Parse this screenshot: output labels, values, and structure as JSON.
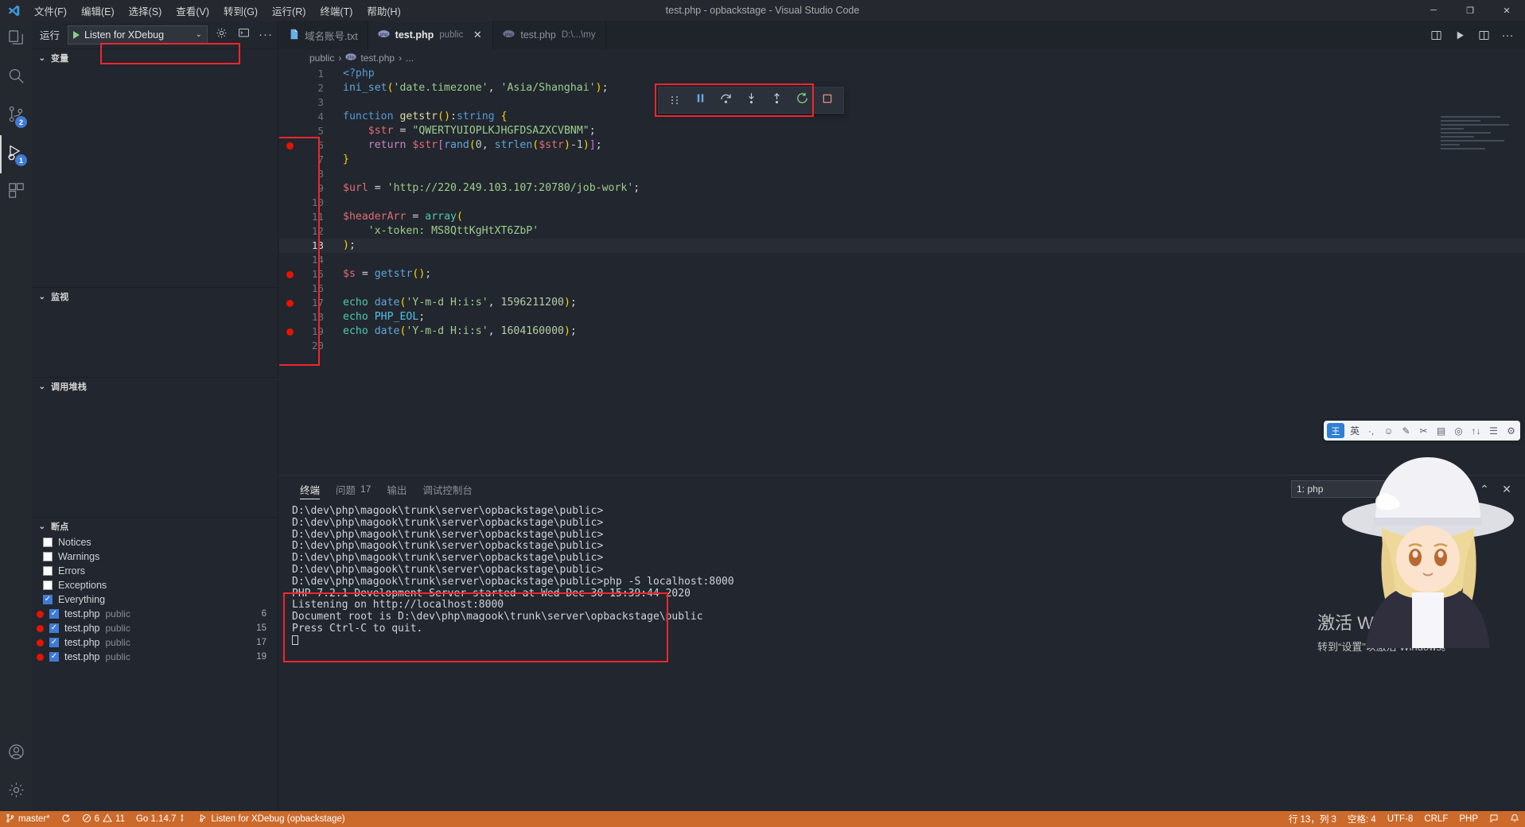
{
  "window": {
    "title": "test.php - opbackstage - Visual Studio Code",
    "minimize": "─",
    "maximize": "❐",
    "close": "✕"
  },
  "menubar": [
    {
      "label": "文件(F)"
    },
    {
      "label": "编辑(E)"
    },
    {
      "label": "选择(S)"
    },
    {
      "label": "查看(V)"
    },
    {
      "label": "转到(G)"
    },
    {
      "label": "运行(R)"
    },
    {
      "label": "终端(T)"
    },
    {
      "label": "帮助(H)"
    }
  ],
  "activitybar": {
    "items": [
      {
        "name": "explorer",
        "icon": "files-icon",
        "badge": ""
      },
      {
        "name": "search",
        "icon": "search-icon",
        "badge": ""
      },
      {
        "name": "source-control",
        "icon": "source-control-icon",
        "badge": "2"
      },
      {
        "name": "run-and-debug",
        "icon": "debug-icon",
        "badge": "1",
        "active": true
      },
      {
        "name": "extensions",
        "icon": "extensions-icon",
        "badge": ""
      }
    ],
    "bottom": [
      {
        "name": "accounts",
        "icon": "account-icon"
      },
      {
        "name": "settings",
        "icon": "gear-icon"
      }
    ]
  },
  "sidebar": {
    "run_label": "运行",
    "launch_config": "Listen for XDebug",
    "launch_caret": "⌄",
    "header_buttons": [
      {
        "name": "open-launch-json",
        "icon": "gear-icon"
      },
      {
        "name": "debug-console-toggle",
        "icon": "debug-console-icon"
      },
      {
        "name": "more-actions",
        "icon": "ellipsis-icon"
      }
    ],
    "sections": [
      {
        "name": "variables",
        "title": "变量"
      },
      {
        "name": "watch",
        "title": "监视"
      },
      {
        "name": "call-stack",
        "title": "调用堆栈"
      },
      {
        "name": "breakpoints",
        "title": "断点"
      }
    ],
    "breakpoint_filters": [
      {
        "label": "Notices",
        "checked": false
      },
      {
        "label": "Warnings",
        "checked": false
      },
      {
        "label": "Errors",
        "checked": false
      },
      {
        "label": "Exceptions",
        "checked": false
      },
      {
        "label": "Everything",
        "checked": true
      }
    ],
    "breakpoints": [
      {
        "file": "test.php",
        "folder": "public",
        "line": "6",
        "checked": true
      },
      {
        "file": "test.php",
        "folder": "public",
        "line": "15",
        "checked": true
      },
      {
        "file": "test.php",
        "folder": "public",
        "line": "17",
        "checked": true
      },
      {
        "file": "test.php",
        "folder": "public",
        "line": "19",
        "checked": true
      }
    ]
  },
  "tabs": [
    {
      "label": "域名账号.txt",
      "desc": "",
      "icon": "text-file-icon",
      "active": false,
      "closable": false
    },
    {
      "label": "test.php",
      "desc": "public",
      "icon": "php-icon",
      "active": true,
      "closable": true
    },
    {
      "label": "test.php",
      "desc": "D:\\...\\my",
      "icon": "php-icon",
      "active": false,
      "closable": false
    }
  ],
  "tab_actions": [
    {
      "name": "split-editor-right",
      "icon": "split-icon"
    },
    {
      "name": "run-file",
      "icon": "play-icon"
    },
    {
      "name": "split-editor",
      "icon": "split-editor-icon"
    },
    {
      "name": "more-actions",
      "icon": "ellipsis-icon"
    }
  ],
  "breadcrumb": [
    "public",
    "test.php",
    "..."
  ],
  "debug_toolbar": [
    {
      "name": "drag-handle",
      "icon": "drag-handle-icon"
    },
    {
      "name": "pause",
      "icon": "pause-icon"
    },
    {
      "name": "step-over",
      "icon": "step-over-icon"
    },
    {
      "name": "step-into",
      "icon": "step-into-icon"
    },
    {
      "name": "step-out",
      "icon": "step-out-icon"
    },
    {
      "name": "restart",
      "icon": "restart-icon"
    },
    {
      "name": "stop",
      "icon": "stop-icon"
    }
  ],
  "editor": {
    "current_line": 13,
    "lines": [
      {
        "n": 1,
        "bp": false,
        "html": "<span class=\"t-tag\">&lt;?php</span>"
      },
      {
        "n": 2,
        "bp": false,
        "html": "<span class=\"t-call\">ini_set</span><span class=\"t-br1\">(</span><span class=\"t-str\">'date.timezone'</span><span class=\"t-punct\">, </span><span class=\"t-str\">'Asia/Shanghai'</span><span class=\"t-br1\">)</span><span class=\"t-punct\">;</span>"
      },
      {
        "n": 3,
        "bp": false,
        "html": ""
      },
      {
        "n": 4,
        "bp": false,
        "html": "<span class=\"t-kw2\">function</span> <span class=\"t-fn\">getstr</span><span class=\"t-br1\">()</span><span class=\"t-punct\">:</span><span class=\"t-kw2\">string</span> <span class=\"t-br1\">{</span>"
      },
      {
        "n": 5,
        "bp": false,
        "html": "    <span class=\"t-var\">$str</span> <span class=\"t-punct\">=</span> <span class=\"t-str\">\"QWERTYUIOPLKJHGFDSAZXCVBNM\"</span><span class=\"t-punct\">;</span>"
      },
      {
        "n": 6,
        "bp": true,
        "html": "    <span class=\"t-kw\">return</span> <span class=\"t-var\">$str</span><span class=\"t-br2\">[</span><span class=\"t-call\">rand</span><span class=\"t-br1\">(</span><span class=\"t-num\">0</span><span class=\"t-punct\">, </span><span class=\"t-call\">strlen</span><span class=\"t-br1\">(</span><span class=\"t-var\">$str</span><span class=\"t-br1\">)</span><span class=\"t-punct\">-</span><span class=\"t-num\">1</span><span class=\"t-br1\">)</span><span class=\"t-br2\">]</span><span class=\"t-punct\">;</span>"
      },
      {
        "n": 7,
        "bp": false,
        "html": "<span class=\"t-br1\">}</span>"
      },
      {
        "n": 8,
        "bp": false,
        "html": ""
      },
      {
        "n": 9,
        "bp": false,
        "html": "<span class=\"t-var\">$url</span> <span class=\"t-punct\">=</span> <span class=\"t-str\">'http://220.249.103.107:20780/job-work'</span><span class=\"t-punct\">;</span>"
      },
      {
        "n": 10,
        "bp": false,
        "html": ""
      },
      {
        "n": 11,
        "bp": false,
        "html": "<span class=\"t-var\">$headerArr</span> <span class=\"t-punct\">=</span> <span class=\"t-type\">array</span><span class=\"t-br1\">(</span>"
      },
      {
        "n": 12,
        "bp": false,
        "html": "    <span class=\"t-str\">'x-token: MS8QttKgHtXT6ZbP'</span>"
      },
      {
        "n": 13,
        "bp": false,
        "html": "<span class=\"t-br1\">)</span><span class=\"t-punct\">;</span>"
      },
      {
        "n": 14,
        "bp": false,
        "html": ""
      },
      {
        "n": 15,
        "bp": true,
        "html": "<span class=\"t-var\">$s</span> <span class=\"t-punct\">=</span> <span class=\"t-call\">getstr</span><span class=\"t-br1\">()</span><span class=\"t-punct\">;</span>"
      },
      {
        "n": 16,
        "bp": false,
        "html": ""
      },
      {
        "n": 17,
        "bp": true,
        "html": "<span class=\"t-type\">echo</span> <span class=\"t-call\">date</span><span class=\"t-br1\">(</span><span class=\"t-str\">'Y-m-d H:i:s'</span><span class=\"t-punct\">, </span><span class=\"t-num\">1596211200</span><span class=\"t-br1\">)</span><span class=\"t-punct\">;</span>"
      },
      {
        "n": 18,
        "bp": false,
        "html": "<span class=\"t-type\">echo</span> <span class=\"t-const\">PHP_EOL</span><span class=\"t-punct\">;</span>"
      },
      {
        "n": 19,
        "bp": true,
        "html": "<span class=\"t-type\">echo</span> <span class=\"t-call\">date</span><span class=\"t-br1\">(</span><span class=\"t-str\">'Y-m-d H:i:s'</span><span class=\"t-punct\">, </span><span class=\"t-num\">1604160000</span><span class=\"t-br1\">)</span><span class=\"t-punct\">;</span>"
      },
      {
        "n": 20,
        "bp": false,
        "html": ""
      }
    ]
  },
  "panel": {
    "tabs": [
      {
        "label": "终端",
        "count": "",
        "active": true
      },
      {
        "label": "问题",
        "count": "17",
        "active": false
      },
      {
        "label": "输出",
        "count": "",
        "active": false
      },
      {
        "label": "调试控制台",
        "count": "",
        "active": false
      }
    ],
    "terminal_select": "1: php",
    "terminal_caret": "⌄",
    "buttons": [
      {
        "name": "new-terminal",
        "icon": "plus-icon"
      },
      {
        "name": "split-terminal",
        "icon": "split-icon"
      },
      {
        "name": "kill-terminal",
        "icon": "trash-icon"
      },
      {
        "name": "maximize-panel",
        "icon": "chevron-up-icon"
      },
      {
        "name": "close-panel",
        "icon": "close-icon"
      }
    ],
    "terminal_lines": [
      "D:\\dev\\php\\magook\\trunk\\server\\opbackstage\\public>",
      "D:\\dev\\php\\magook\\trunk\\server\\opbackstage\\public>",
      "D:\\dev\\php\\magook\\trunk\\server\\opbackstage\\public>",
      "D:\\dev\\php\\magook\\trunk\\server\\opbackstage\\public>",
      "D:\\dev\\php\\magook\\trunk\\server\\opbackstage\\public>",
      "D:\\dev\\php\\magook\\trunk\\server\\opbackstage\\public>",
      "D:\\dev\\php\\magook\\trunk\\server\\opbackstage\\public>php -S localhost:8000",
      "PHP 7.2.1 Development Server started at Wed Dec 30 15:39:44 2020",
      "Listening on http://localhost:8000",
      "Document root is D:\\dev\\php\\magook\\trunk\\server\\opbackstage\\public",
      "Press Ctrl-C to quit."
    ]
  },
  "statusbar": {
    "left": [
      {
        "name": "branch",
        "icon": "source-control-icon",
        "label": "master*"
      },
      {
        "name": "sync",
        "icon": "sync-icon",
        "label": ""
      },
      {
        "name": "problems",
        "icon": "error-icon",
        "label": "6  11"
      },
      {
        "name": "go-version",
        "icon": "",
        "label": "Go 1.14.7"
      },
      {
        "name": "debug-session",
        "icon": "debug-icon",
        "label": "Listen for XDebug (opbackstage)"
      }
    ],
    "problems_errors": "6",
    "problems_warnings": "11",
    "right": [
      {
        "name": "cursor-position",
        "label": "行 13，列 3"
      },
      {
        "name": "indentation",
        "label": "空格: 4"
      },
      {
        "name": "encoding",
        "label": "UTF-8"
      },
      {
        "name": "eol",
        "label": "CRLF"
      },
      {
        "name": "language-mode",
        "label": "PHP"
      },
      {
        "name": "feedback",
        "label": "☺"
      },
      {
        "name": "notifications",
        "label": "🔔"
      }
    ]
  },
  "watermark": {
    "line1": "激活 Windows",
    "line2": "转到“设置”以激活 Windows。"
  },
  "ime": {
    "logo": "王",
    "mode": "英",
    "items": [
      "·,",
      "☺",
      "✎",
      "✂",
      "▤",
      "◎",
      "↑↓",
      "☰",
      "⚙"
    ]
  },
  "colors": {
    "accent": "#3f7bd4",
    "breakpoint": "#e51400",
    "statusbar": "#cb6a2b",
    "highlight_box": "#f0262d",
    "editor_bg": "#22262e"
  }
}
